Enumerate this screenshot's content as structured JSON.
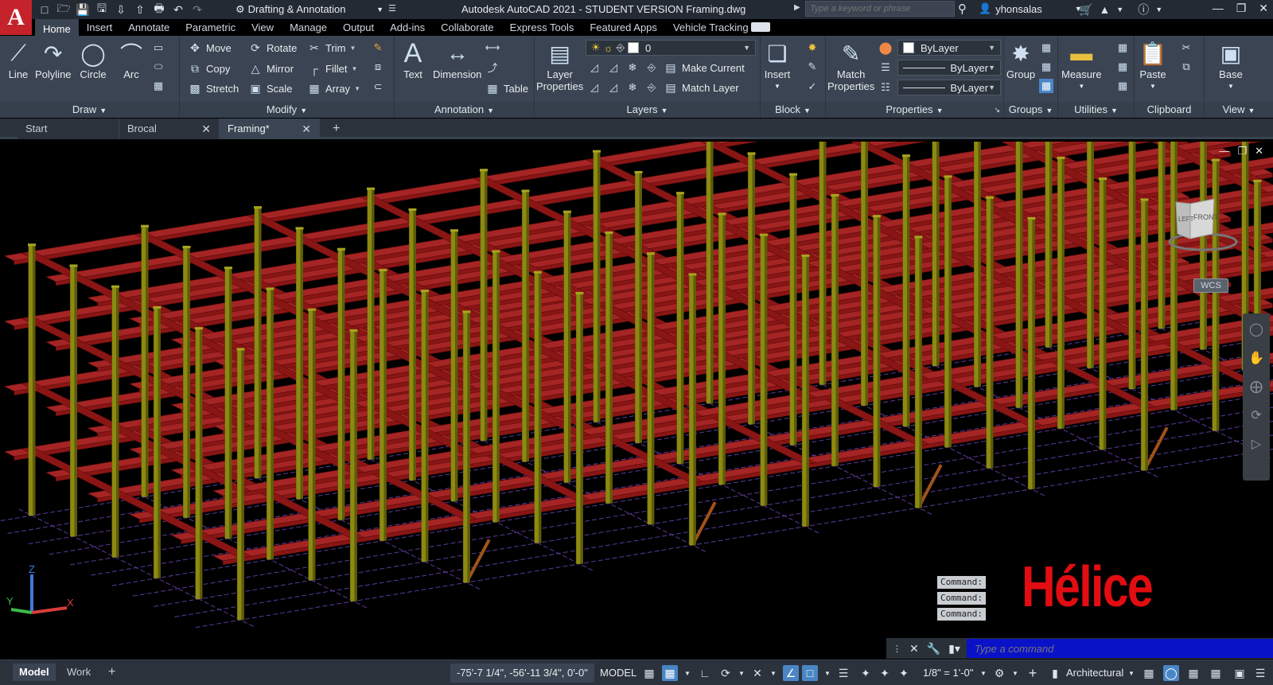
{
  "title_bar": {
    "app_logo": "A",
    "workspace": "Drafting & Annotation",
    "window_title": "Autodesk AutoCAD 2021 - STUDENT VERSION    Framing.dwg",
    "search_placeholder": "Type a keyword or phrase",
    "username": "yhonsalas",
    "qat_icons": [
      "new-icon",
      "open-icon",
      "save-icon",
      "save-as-icon",
      "open-web-icon",
      "save-web-icon",
      "plot-icon",
      "undo-icon",
      "redo-icon"
    ]
  },
  "ribbon_tabs": [
    {
      "label": "Home",
      "active": true
    },
    {
      "label": "Insert"
    },
    {
      "label": "Annotate"
    },
    {
      "label": "Parametric"
    },
    {
      "label": "View"
    },
    {
      "label": "Manage"
    },
    {
      "label": "Output"
    },
    {
      "label": "Add-ins"
    },
    {
      "label": "Collaborate"
    },
    {
      "label": "Express Tools"
    },
    {
      "label": "Featured Apps"
    },
    {
      "label": "Vehicle Tracking"
    }
  ],
  "ribbon": {
    "draw": {
      "title": "Draw",
      "line": "Line",
      "polyline": "Polyline",
      "circle": "Circle",
      "arc": "Arc"
    },
    "modify": {
      "title": "Modify",
      "move": "Move",
      "rotate": "Rotate",
      "trim": "Trim",
      "copy": "Copy",
      "mirror": "Mirror",
      "fillet": "Fillet",
      "stretch": "Stretch",
      "scale": "Scale",
      "array": "Array"
    },
    "annotation": {
      "title": "Annotation",
      "text": "Text",
      "dimension": "Dimension",
      "table": "Table"
    },
    "layers": {
      "title": "Layers",
      "layer_properties_1": "Layer",
      "layer_properties_2": "Properties",
      "current_layer": "0",
      "make_current": "Make Current",
      "match_layer": "Match Layer"
    },
    "block": {
      "title": "Block",
      "insert": "Insert"
    },
    "properties": {
      "title": "Properties",
      "match_properties_1": "Match",
      "match_properties_2": "Properties",
      "color": "ByLayer",
      "linetype": "ByLayer",
      "lineweight": "ByLayer"
    },
    "groups": {
      "title": "Groups",
      "group": "Group"
    },
    "utilities": {
      "title": "Utilities",
      "measure": "Measure"
    },
    "clipboard": {
      "title": "Clipboard",
      "paste": "Paste"
    },
    "view": {
      "title": "View",
      "base": "Base"
    }
  },
  "doc_tabs": [
    {
      "label": "Start"
    },
    {
      "label": "Brocal"
    },
    {
      "label": "Framing*",
      "active": true
    }
  ],
  "viewcube": {
    "left": "LEFT",
    "front": "FRONT",
    "wcs": "WCS"
  },
  "ucs": {
    "x": "X",
    "y": "Y",
    "z": "Z"
  },
  "command_history": [
    "Command:",
    "Command:",
    "Command:"
  ],
  "command_input_placeholder": "Type a command",
  "watermark": "Hélice",
  "statusbar": {
    "layout_tabs": [
      {
        "label": "Model",
        "active": true
      },
      {
        "label": "Work"
      }
    ],
    "coordinates": "-75'-7 1/4\", -56'-11 3/4\", 0'-0\"",
    "model": "MODEL",
    "annotation_scale": "1/8\" = 1'-0\"",
    "units": "Architectural"
  },
  "colors": {
    "slab": "#8a1515",
    "slab_top": "#a52424",
    "column": "#8c8a12",
    "grid": "#5a3a9a",
    "brace": "#a0521a",
    "ribbon_bg": "#3a4452",
    "title_bg": "#232a33"
  }
}
